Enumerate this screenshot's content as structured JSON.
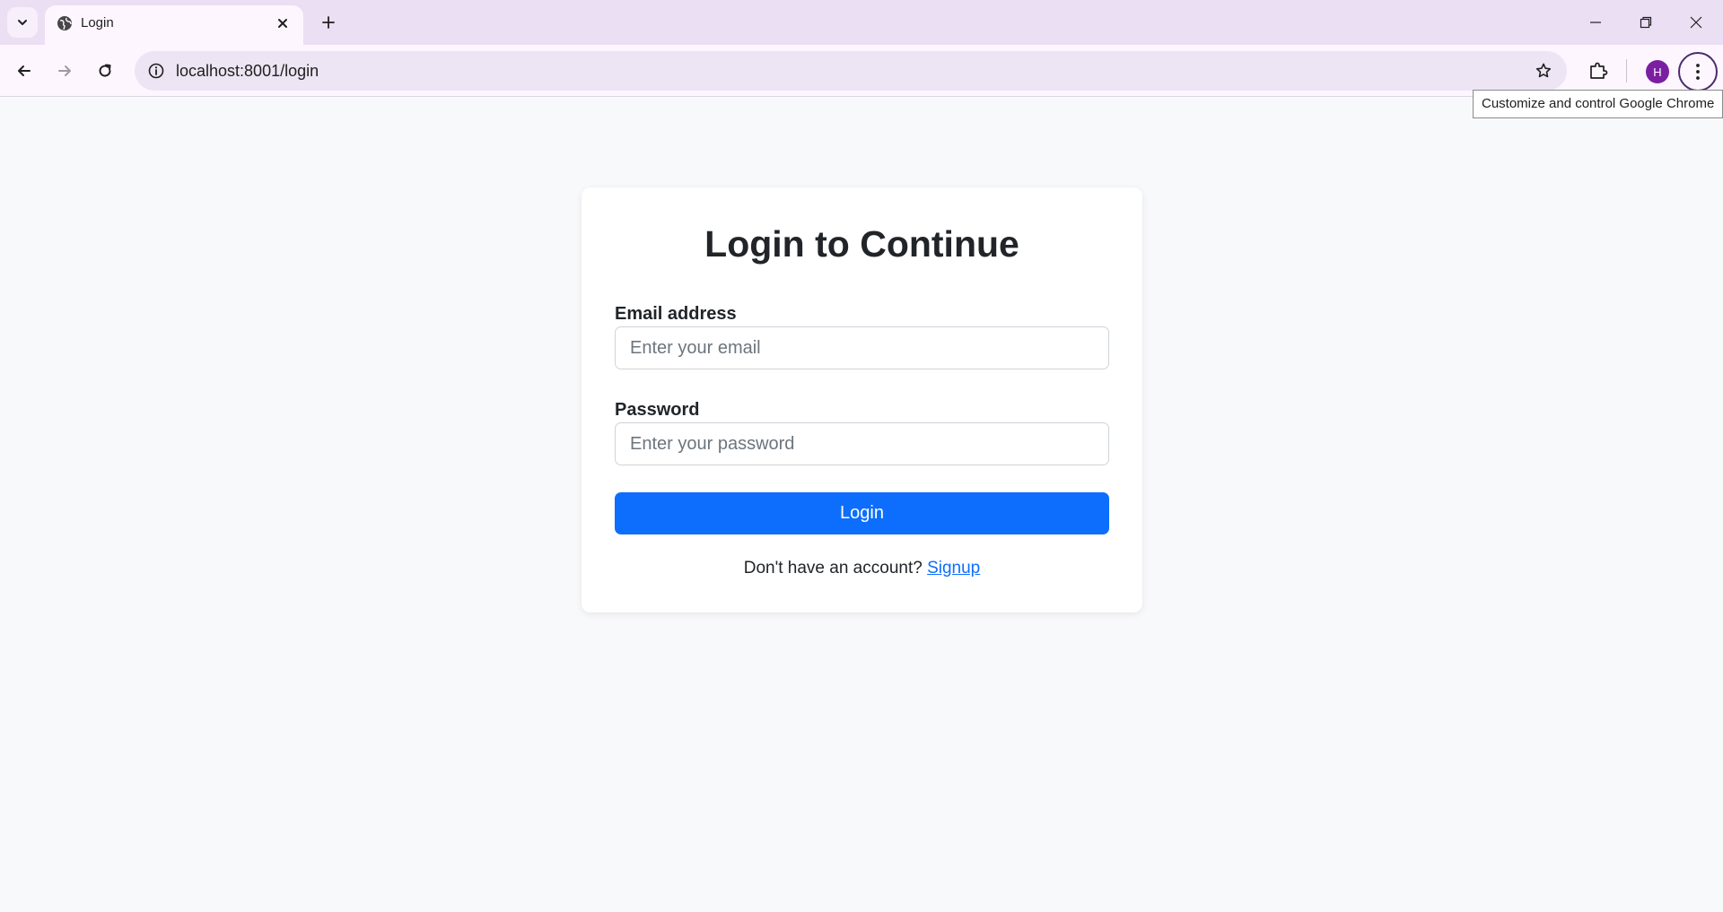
{
  "browser": {
    "tab_title": "Login",
    "url": "localhost:8001/login",
    "profile_initial": "H",
    "tooltip": "Customize and control Google Chrome",
    "icons": {
      "tab_search": "chevron-down-icon",
      "favicon": "globe-icon",
      "tab_close": "close-icon",
      "new_tab": "plus-icon",
      "minimize": "minimize-icon",
      "restore": "restore-icon",
      "close_window": "close-icon",
      "back": "arrow-left-icon",
      "forward": "arrow-right-icon",
      "reload": "reload-icon",
      "site_info": "info-icon",
      "bookmark": "star-icon",
      "extensions": "puzzle-icon",
      "menu": "kebab-menu-icon"
    },
    "colors": {
      "tabstrip": "#ebdff4",
      "toolbar": "#fdf6ff",
      "avatar": "#7b1fa2"
    }
  },
  "page": {
    "heading": "Login to Continue",
    "email": {
      "label": "Email address",
      "placeholder": "Enter your email",
      "value": ""
    },
    "password": {
      "label": "Password",
      "placeholder": "Enter your password",
      "value": ""
    },
    "login_button": "Login",
    "signup_prompt": "Don't have an account?",
    "signup_link": "Signup",
    "colors": {
      "primary": "#0d6efd",
      "background": "#f8f9fa",
      "card": "#ffffff"
    }
  }
}
